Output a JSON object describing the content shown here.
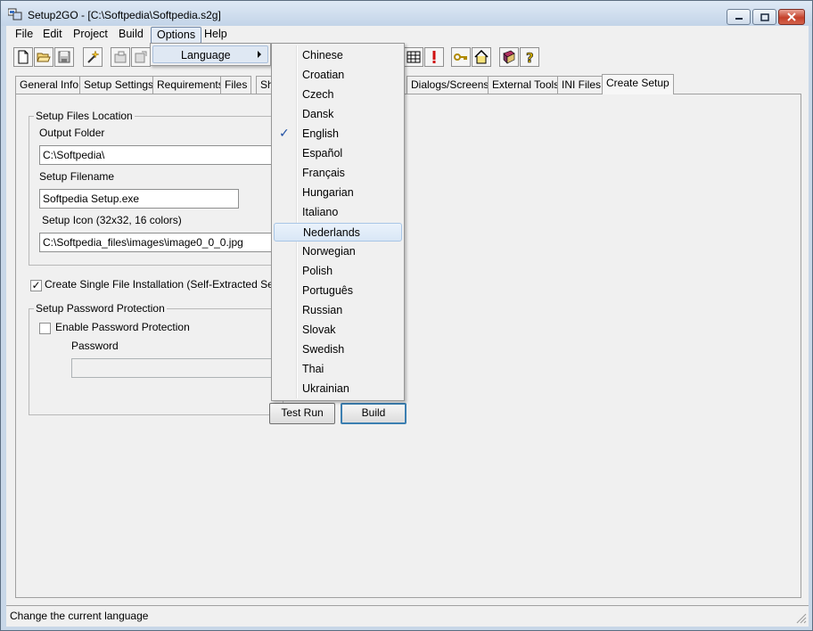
{
  "window": {
    "title": "Setup2GO - [C:\\Softpedia\\Softpedia.s2g]"
  },
  "menubar": {
    "items": [
      "File",
      "Edit",
      "Project",
      "Build",
      "Options",
      "Help"
    ]
  },
  "toolbar": {
    "icons": [
      "new-file-icon",
      "open-folder-icon",
      "save-icon",
      "wizard-wand-icon",
      "compile-icon",
      "export-icon",
      "grid-icon",
      "exclamation-icon",
      "key-icon",
      "home-icon",
      "book-icon",
      "help-icon"
    ]
  },
  "tabs": [
    "General Info",
    "Setup Settings",
    "Requirements",
    "Files",
    "Sh",
    "Dialogs/Screens",
    "External Tools",
    "INI Files",
    "Create Setup"
  ],
  "create_setup": {
    "files_group_title": "Setup Files Location",
    "output_folder_label": "Output Folder",
    "output_folder_value": "C:\\Softpedia\\",
    "setup_filename_label": "Setup Filename",
    "setup_filename_value": "Softpedia Setup.exe",
    "setup_icon_label": "Setup Icon (32x32, 16 colors)",
    "setup_icon_value": "C:\\Softpedia_files\\images\\image0_0_0.jpg",
    "single_file_label": "Create Single File Installation (Self-Extracted Setup)",
    "single_file_checked": true,
    "password_group_title": "Setup Password Protection",
    "enable_password_label": "Enable Password Protection",
    "enable_password_checked": false,
    "password_label": "Password",
    "password_value": "",
    "test_run_label": "Test Run",
    "build_label": "Build"
  },
  "options_menu": {
    "language_label": "Language"
  },
  "language_menu": {
    "items": [
      "Chinese",
      "Croatian",
      "Czech",
      "Dansk",
      "English",
      "Español",
      "Français",
      "Hungarian",
      "Italiano",
      "Nederlands",
      "Norwegian",
      "Polish",
      "Português",
      "Russian",
      "Slovak",
      "Swedish",
      "Thai",
      "Ukrainian"
    ],
    "checked": "English",
    "highlighted": "Nederlands",
    "check_glyph": "✓"
  },
  "statusbar": {
    "text": "Change the current language"
  },
  "colors": {
    "highlight": "#d9e7f6",
    "check": "#1e4fa3",
    "title_gradient_top": "#dfe9f5"
  }
}
